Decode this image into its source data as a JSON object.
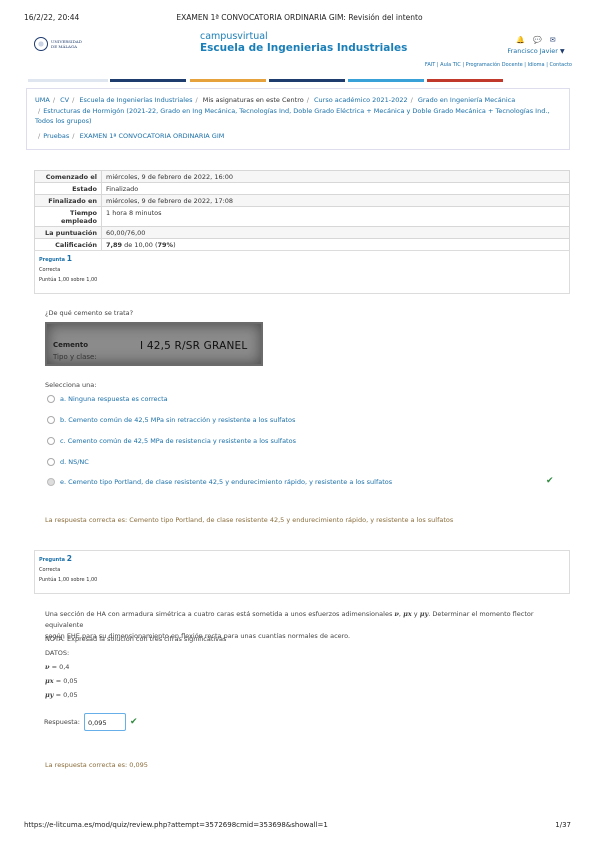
{
  "print": {
    "date": "16/2/22, 20:44",
    "title": "EXAMEN 1ª CONVOCATORIA ORDINARIA GIM: Revisión del intento",
    "url": "https://e-litcuma.es/mod/quiz/review.php?attempt=3572698cmid=353698&showall=1",
    "page": "1/37"
  },
  "header": {
    "logo_text": "UNIVERSIDAD\nDE MÁLAGA",
    "campus": "campusvirtual",
    "school": "Escuela de Ingenierias Industriales",
    "user_name": "Francisco Javier",
    "icons": [
      "bell-icon",
      "chat-icon",
      "mail-icon"
    ],
    "toplinks": "FAIT | Aula TIC | Programación Docente | Idioma | Contacto"
  },
  "colors": {
    "bar": [
      "#1f3c6e",
      "#e6a23c",
      "#1f3c6e",
      "#3aa0d8",
      "#c0392b"
    ],
    "accent": "#1a7fb8",
    "correct": "#2e8b3e",
    "feedback": "#8a6d3b"
  },
  "breadcrumb": {
    "row1": [
      "UMA",
      "CV",
      "Escuela de Ingenierías Industriales",
      "Mis asignaturas en este Centro",
      "Curso académico 2021-2022",
      "Grado en Ingeniería Mecánica"
    ],
    "row2": "Estructuras de Hormigón (2021-22, Grado en Ing Mecánica, Tecnologías Ind, Doble Grado Eléctrica + Mecánica y Doble Grado Mecánica + Tecnologías Ind., Todos los grupos)",
    "row3": [
      "Pruebas",
      "EXAMEN 1ª CONVOCATORIA ORDINARIA GIM"
    ]
  },
  "summary": [
    {
      "label": "Comenzado el",
      "value": "miércoles, 9 de febrero de 2022, 16:00"
    },
    {
      "label": "Estado",
      "value": "Finalizado"
    },
    {
      "label": "Finalizado en",
      "value": "miércoles, 9 de febrero de 2022, 17:08"
    },
    {
      "label": "Tiempo\nempleado",
      "value": "1 hora 8 minutos"
    },
    {
      "label": "La puntuación",
      "value": "60,00/76,00"
    },
    {
      "label": "Calificación",
      "value_bold": "7,89",
      "value_mid": " de 10,00 (",
      "value_pct": "79%",
      "value_end": ")"
    }
  ],
  "q1": {
    "label": "Pregunta ",
    "number": "1",
    "state": "Correcta",
    "score": "Puntúa 1,00 sobre 1,00",
    "text": "¿De qué cemento se trata?",
    "img_label1": "Cemento",
    "img_label2": "Tipo y clase:",
    "img_value": "I 42,5 R/SR GRANEL",
    "select_label": "Selecciona una:",
    "options": [
      "a. Ninguna respuesta es correcta",
      "b. Cemento común de 42,5 MPa sin retracción y resistente a los sulfatos",
      "c. Cemento común de 42,5 MPa de resistencia y resistente a los sulfatos",
      "d. NS/NC",
      "e. Cemento tipo Portland, de clase resistente 42,5 y endurecimiento rápido, y resistente a los sulfatos"
    ],
    "feedback": "La respuesta correcta es: Cemento tipo Portland, de clase resistente 42,5 y endurecimiento rápido, y resistente a los sulfatos"
  },
  "q2": {
    "label": "Pregunta ",
    "number": "2",
    "state": "Correcta",
    "score": "Puntúa 1,00 sobre 1,00",
    "text_a": "Una sección de HA con armadura simétrica a cuatro caras está sometida a unos esfuerzos adimensionales ",
    "text_sym1": "ν",
    "text_sep1": ", ",
    "text_sym2": "μx",
    "text_sep2": " y ",
    "text_sym3": "μy",
    "text_b": ". Determinar el momento flector equivalente",
    "text_line2": "según EHE para su dimensionamiento en flexión recta para unas cuantías normales de acero.",
    "note": "NOTA:  Expresad la solución con tres cifras significativas",
    "datos_label": "DATOS:",
    "datos": [
      {
        "sym": "ν",
        "val": " = 0,4"
      },
      {
        "sym": "μx",
        "val": " = 0,05"
      },
      {
        "sym": "μy",
        "val": " = 0,05"
      }
    ],
    "answer_label": "Respuesta:",
    "answer_value": "0,095",
    "feedback": "La respuesta correcta es: 0,095"
  }
}
